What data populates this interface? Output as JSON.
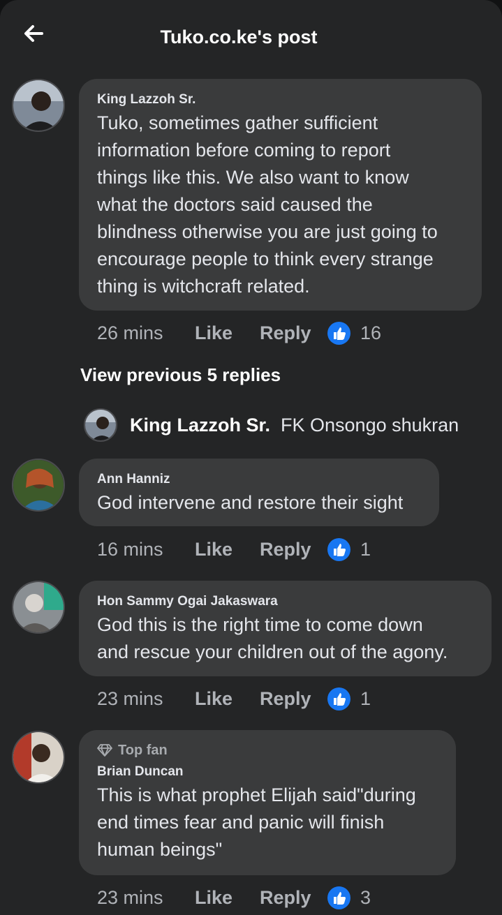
{
  "header": {
    "title": "Tuko.co.ke's post",
    "back_icon": "arrow-left-icon"
  },
  "comments": [
    {
      "author": "King Lazzoh Sr.",
      "text_lines": [
        "Tuko, sometimes gather sufficient",
        "information before coming to report",
        "things like this. We also want to know",
        "what the doctors said caused the",
        "blindness otherwise you are just going to",
        "encourage people to think every strange",
        "thing is witchcraft related."
      ],
      "time": "26 mins",
      "like_label": "Like",
      "reply_label": "Reply",
      "reactions": "16"
    },
    {
      "author": "Ann Hanniz",
      "text_lines": [
        "God intervene and restore their sight"
      ],
      "time": "16 mins",
      "like_label": "Like",
      "reply_label": "Reply",
      "reactions": "1"
    },
    {
      "author": "Hon Sammy Ogai Jakaswara",
      "text_lines": [
        "God this is the right time to come down",
        "and rescue your children out of the agony."
      ],
      "time": "23 mins",
      "like_label": "Like",
      "reply_label": "Reply",
      "reactions": "1"
    },
    {
      "badge": "Top fan",
      "author": "Brian Duncan",
      "text_lines": [
        "This is what prophet Elijah said\"during",
        "end times fear and panic will finish",
        "human beings\""
      ],
      "time": "23 mins",
      "like_label": "Like",
      "reply_label": "Reply",
      "reactions": "3"
    }
  ],
  "view_previous": "View previous 5 replies",
  "latest_reply": {
    "author": "King Lazzoh Sr.",
    "text": "FK Onsongo shukran"
  },
  "colors": {
    "background": "#242526",
    "bubble": "#3a3b3c",
    "like_blue": "#1877f2"
  }
}
